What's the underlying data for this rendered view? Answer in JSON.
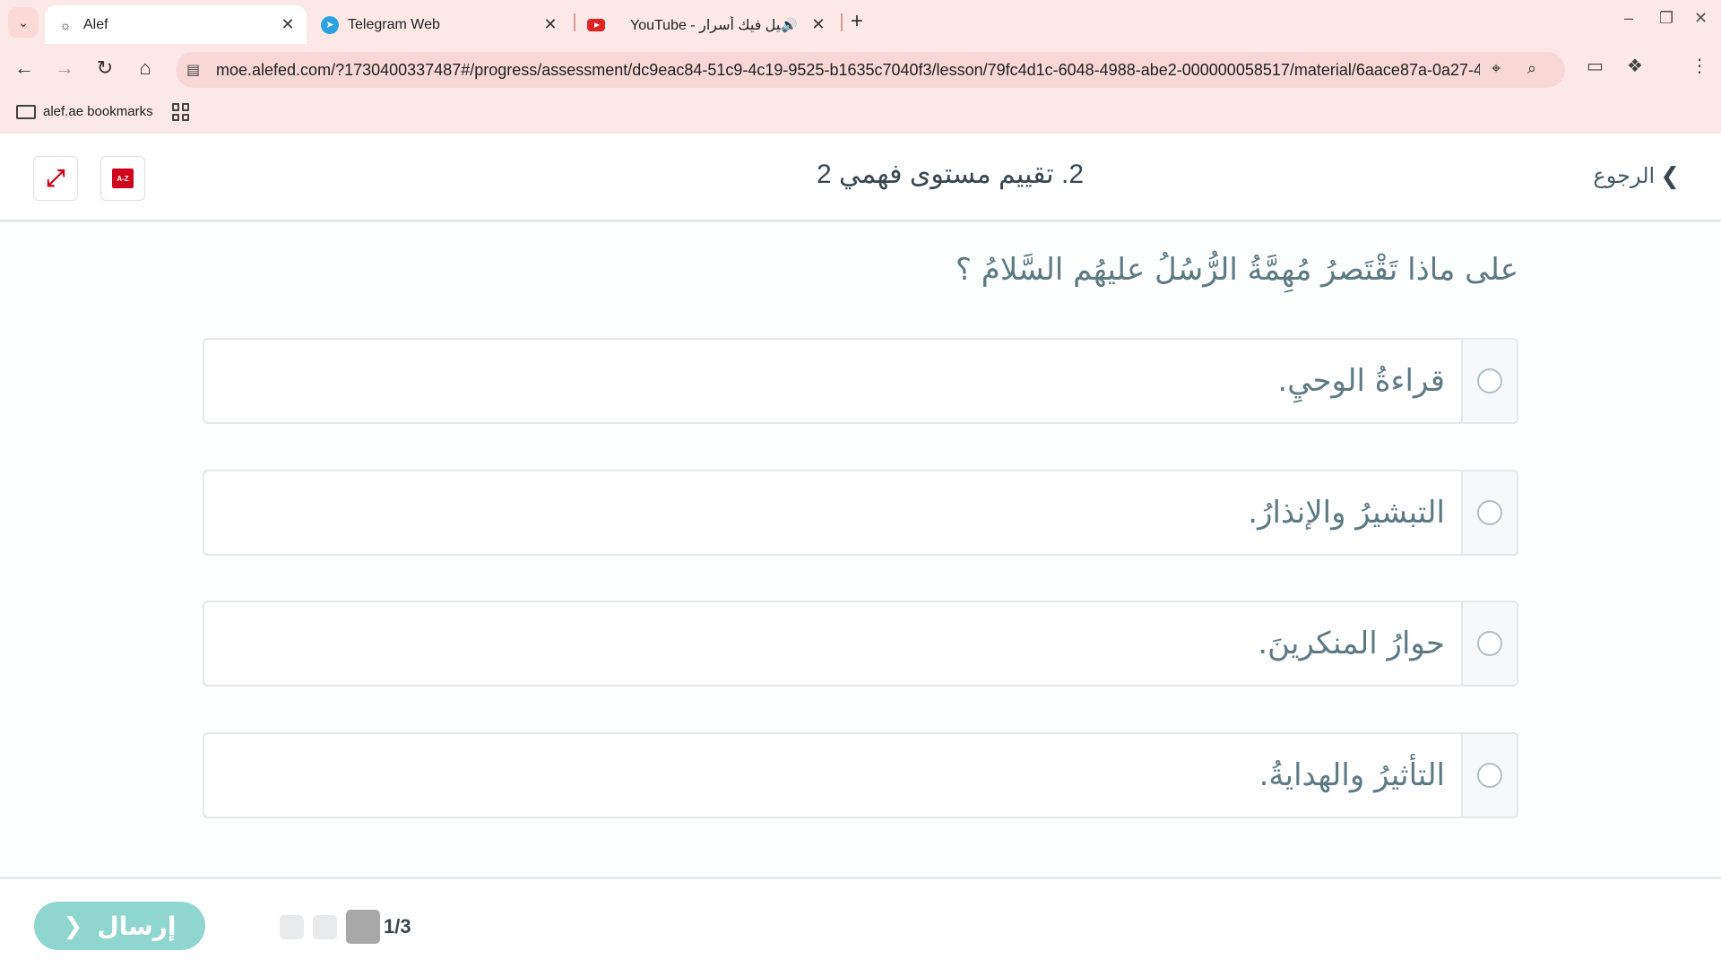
{
  "browser": {
    "tabs": [
      {
        "title": "Alef",
        "active": true
      },
      {
        "title": "Telegram Web",
        "active": false
      },
      {
        "title": "YouTube - يا ليل فيك أسرار",
        "active": false
      }
    ],
    "url": "moe.alefed.com/?1730400337487#/progress/assessment/dc9eac84-51c9-4c19-9525-b1635c7040f3/lesson/79fc4d1c-6048-4988-abe2-000000058517/material/6aace87a-0a27-4...",
    "bookmark": "alef.ae bookmarks"
  },
  "header": {
    "title": "2. تقييم مستوى فهمي 2",
    "back_label": "الرجوع",
    "dictionary_icon_text": "A-Z"
  },
  "question": {
    "text": "على ماذا تَقْتَصرُ مُهِمَّةُ الرُّسُلُ عليهُم السَّلامُ ؟",
    "options": [
      {
        "label": "قراءةُ الوحيِ."
      },
      {
        "label": "التبشيرُ والإنذارُ."
      },
      {
        "label": "حوارُ المنكرينَ."
      },
      {
        "label": "التأثيرُ والهدايةُ."
      }
    ]
  },
  "footer": {
    "submit_label": "إرسال",
    "page_count": "1/3"
  },
  "colors": {
    "accent_red": "#d0021b",
    "submit_teal": "#8fd6d1",
    "question_text": "#5d7a84"
  }
}
